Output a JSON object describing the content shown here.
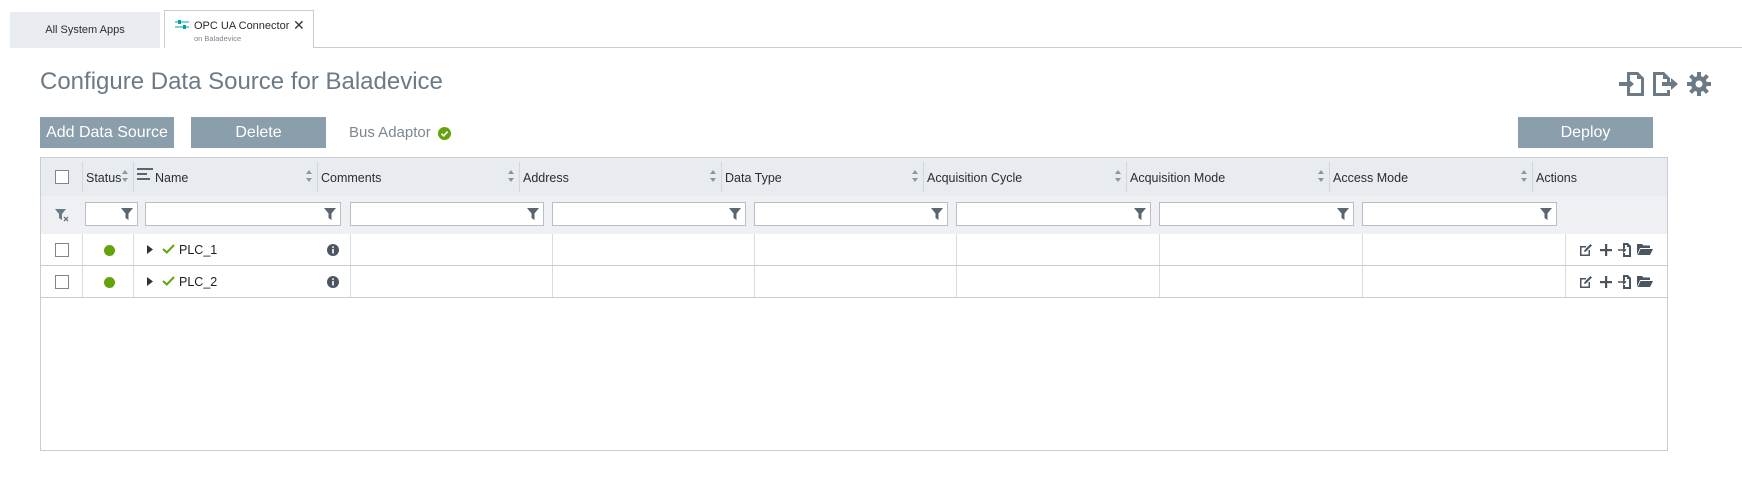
{
  "tabs": {
    "inactive_label": "All System Apps",
    "active_title": "OPC UA Connector",
    "active_subtitle": "on Baladevice"
  },
  "page": {
    "title": "Configure Data Source for Baladevice",
    "header_icons": [
      "import-icon",
      "export-icon",
      "gear-icon"
    ]
  },
  "toolbar": {
    "add_label": "Add Data Source",
    "delete_label": "Delete",
    "bus_label": "Bus Adaptor",
    "bus_status": "ok",
    "deploy_label": "Deploy"
  },
  "table": {
    "columns": [
      "Status",
      "Name",
      "Comments",
      "Address",
      "Data Type",
      "Acquisition Cycle",
      "Acquisition Mode",
      "Access Mode",
      "Actions"
    ],
    "rows": [
      {
        "name": "PLC_1",
        "status": "connected"
      },
      {
        "name": "PLC_2",
        "status": "connected"
      }
    ],
    "row_actions": [
      "edit-icon",
      "add-icon",
      "import-icon",
      "folder-icon"
    ]
  },
  "colors": {
    "accent": "#8a9eac",
    "title": "#6c7a86",
    "ok_green": "#65a30d",
    "header_bg": "#e8ebef"
  }
}
